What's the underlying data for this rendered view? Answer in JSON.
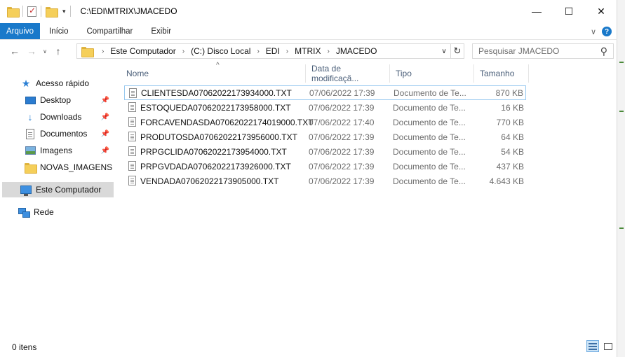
{
  "window": {
    "title": "C:\\EDI\\MTRIX\\JMACEDO",
    "qa_dropdown": "▾",
    "controls": {
      "minimize": "—",
      "maximize": "☐",
      "close": "✕"
    }
  },
  "ribbon": {
    "tabs": [
      {
        "label": "Arquivo"
      },
      {
        "label": "Início"
      },
      {
        "label": "Compartilhar"
      },
      {
        "label": "Exibir"
      }
    ],
    "expand_glyph": "∨",
    "help_glyph": "?"
  },
  "nav": {
    "back": "←",
    "forward": "→",
    "recent": "∨",
    "up": "↑",
    "separator_glyph": "›",
    "breadcrumbs": [
      "Este Computador",
      "(C:) Disco Local",
      "EDI",
      "MTRIX",
      "JMACEDO"
    ],
    "address_dropdown": "∨",
    "refresh": "↻",
    "search_placeholder": "Pesquisar JMACEDO",
    "search_glyph": "⚲"
  },
  "sidebar": {
    "pin_glyph": "📌",
    "star_glyph": "★",
    "download_glyph": "↓",
    "quick_access": "Acesso rápido",
    "items": [
      {
        "label": "Desktop",
        "pinned": true,
        "icon": "desktop-icon"
      },
      {
        "label": "Downloads",
        "pinned": true,
        "icon": "downloads-icon"
      },
      {
        "label": "Documentos",
        "pinned": true,
        "icon": "documents-icon"
      },
      {
        "label": "Imagens",
        "pinned": true,
        "icon": "pictures-icon"
      },
      {
        "label": "NOVAS_IMAGENS",
        "pinned": false,
        "icon": "folder-icon"
      }
    ],
    "this_pc": "Este Computador",
    "network": "Rede"
  },
  "columns": {
    "name": "Nome",
    "date": "Data de modificaçã...",
    "type": "Tipo",
    "size": "Tamanho",
    "sort_glyph": "^"
  },
  "files": [
    {
      "name": "CLIENTESDA07062022173934000.TXT",
      "date": "07/06/2022 17:39",
      "type": "Documento de Te...",
      "size": "870 KB"
    },
    {
      "name": "ESTOQUEDA07062022173958000.TXT",
      "date": "07/06/2022 17:39",
      "type": "Documento de Te...",
      "size": "16 KB"
    },
    {
      "name": "FORCAVENDASDA07062022174019000.TXT",
      "date": "07/06/2022 17:40",
      "type": "Documento de Te...",
      "size": "770 KB"
    },
    {
      "name": "PRODUTOSDA07062022173956000.TXT",
      "date": "07/06/2022 17:39",
      "type": "Documento de Te...",
      "size": "64 KB"
    },
    {
      "name": "PRPGCLIDA07062022173954000.TXT",
      "date": "07/06/2022 17:39",
      "type": "Documento de Te...",
      "size": "54 KB"
    },
    {
      "name": "PRPGVDADA07062022173926000.TXT",
      "date": "07/06/2022 17:39",
      "type": "Documento de Te...",
      "size": "437 KB"
    },
    {
      "name": "VENDADA07062022173905000.TXT",
      "date": "07/06/2022 17:39",
      "type": "Documento de Te...",
      "size": "4.643 KB"
    }
  ],
  "status": {
    "count": "0 itens"
  },
  "colors": {
    "accent": "#1979ca",
    "selection": "#d9d9d9",
    "focus_border": "#99c9ef",
    "header_text": "#4c607a"
  }
}
